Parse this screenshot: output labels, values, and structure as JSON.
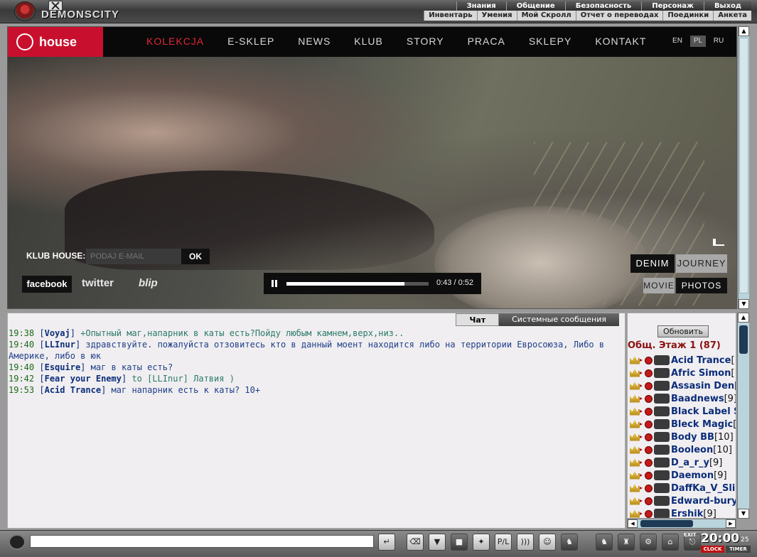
{
  "game": {
    "logo_text": "DEMONSCITY",
    "menu_top": [
      "Знания",
      "Общение",
      "Безопасность",
      "Персонаж",
      "Выход"
    ],
    "menu_bottom": [
      "Инвентарь",
      "Умения",
      "Мой Скролл",
      "Отчет о переводах",
      "Поединки",
      "Анкета"
    ]
  },
  "site": {
    "logo": "house",
    "nav": [
      "KOLEKCJA",
      "E-SKLEP",
      "NEWS",
      "KLUB",
      "STORY",
      "PRACA",
      "SKLEPY",
      "KONTAKT"
    ],
    "active_nav": "KOLEKCJA",
    "langs": [
      "EN",
      "PL",
      "RU"
    ],
    "selected_lang": "PL",
    "klub_label": "KLUB HOUSE:",
    "email_placeholder": "PODAJ E-MAIL",
    "ok_label": "OK",
    "social": [
      "facebook",
      "twitter",
      "blip"
    ],
    "player": {
      "time": "0:43 / 0:52",
      "progress": 0.83
    },
    "modes": {
      "denim": "DENIM",
      "journey": "JOURNEY",
      "movie": "MOVIE",
      "photos": "PHOTOS"
    },
    "accent_color": "#c8102e"
  },
  "chat": {
    "tabs": {
      "chat": "Чат",
      "system": "Системные сообщения"
    },
    "messages": [
      {
        "time": "19:38",
        "nick": "Voyaj",
        "text": "+Опытный маг,напарник в каты есть?Пойду любым камнем,верх,низ..",
        "color": "green"
      },
      {
        "time": "19:40",
        "nick": "LLInur",
        "text": "здравствуйте. пожалуйста отзовитесь кто в данный моент находится либо на территории Евросоюза, Либо в Америке, либо в юк",
        "color": "blue"
      },
      {
        "time": "19:40",
        "nick": "Esquire",
        "text": "маг в каты есть?",
        "color": "blue"
      },
      {
        "time": "19:42",
        "nick": "Fear your Enemy",
        "text": "to [LLInur] Латвия )",
        "color": "green"
      },
      {
        "time": "19:53",
        "nick": "Acid Trance",
        "text": "маг напарник есть к каты? 10+",
        "color": "blue"
      }
    ]
  },
  "userlist": {
    "refresh_label": "Обновить",
    "room_title": "Общ. Этаж 1 (87)",
    "users": [
      {
        "name": "Acid Trance",
        "level": "[1"
      },
      {
        "name": "Afric Simon",
        "level": "[1"
      },
      {
        "name": "Assasin Den",
        "level": "["
      },
      {
        "name": "Baadnews",
        "level": "[9]"
      },
      {
        "name": "Black Label S",
        "level": ""
      },
      {
        "name": "Bleck Magic",
        "level": "[1"
      },
      {
        "name": "Body BB",
        "level": "[10]"
      },
      {
        "name": "Booleon",
        "level": "[10]"
      },
      {
        "name": "D_a_r_y",
        "level": "[9]"
      },
      {
        "name": "Daemon",
        "level": "[9]"
      },
      {
        "name": "DaffKa_V_Sli",
        "level": ""
      },
      {
        "name": "Edward-bury",
        "level": ""
      },
      {
        "name": "Ershik",
        "level": "[9]"
      }
    ]
  },
  "toolbar": {
    "tools": [
      "eraser-icon",
      "filter-icon",
      "save-icon",
      "dance-icon",
      "pl-icon",
      "sound-icon",
      "smile-icon",
      "horse-icon"
    ],
    "tools_labels": [
      "⌫",
      "▼",
      "■",
      "✦",
      "P/L",
      ")))",
      "☺",
      "♞"
    ],
    "right_tools_labels": [
      "♞",
      "♜",
      "⚙",
      "⌂",
      "⎋"
    ],
    "exit_label": "EXIT",
    "clock": {
      "time": "20:00",
      "seconds": "25",
      "clock_label": "CLOCK",
      "timer_label": "TIMER"
    }
  }
}
